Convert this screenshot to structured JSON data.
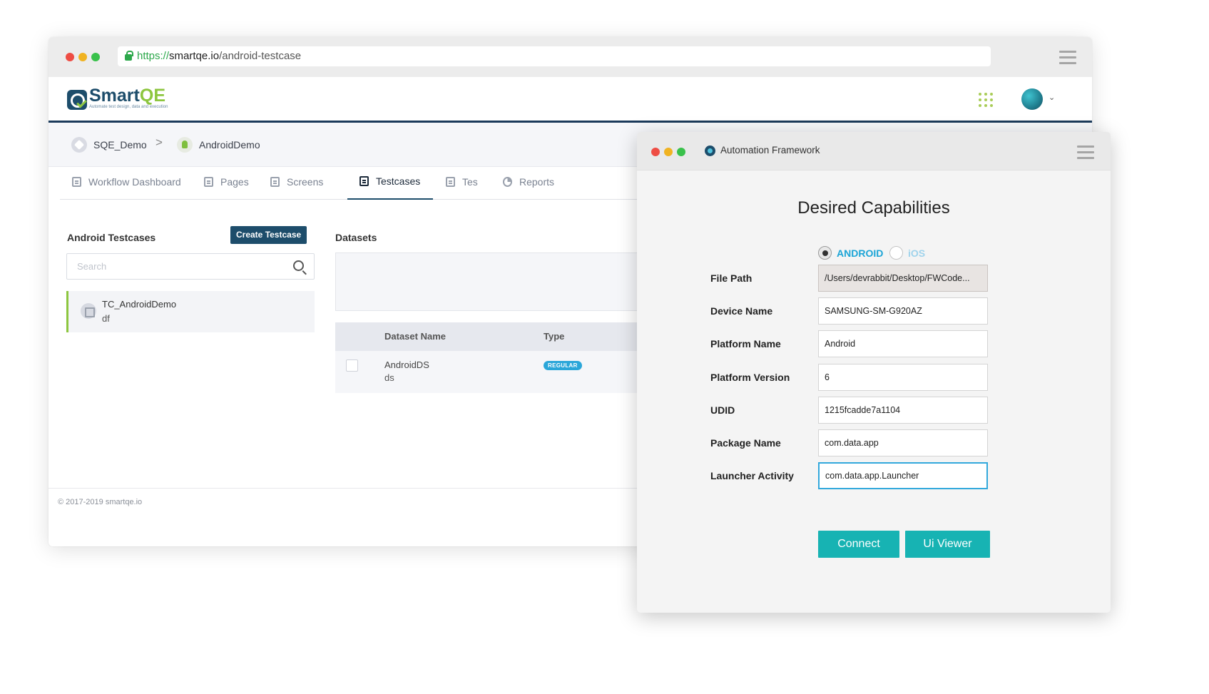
{
  "browser": {
    "url_protocol": "https://",
    "url_domain": "smartqe.io",
    "url_path": "/android-testcase"
  },
  "app": {
    "logo_name_a": "Smart",
    "logo_name_b": "QE",
    "logo_tagline": "Automate test design, data and execution"
  },
  "breadcrumb": {
    "items": [
      "SQE_Demo",
      "AndroidDemo"
    ],
    "separator": ">"
  },
  "tabs": [
    {
      "label": "Workflow Dashboard",
      "icon": "document-icon"
    },
    {
      "label": "Pages",
      "icon": "document-icon"
    },
    {
      "label": "Screens",
      "icon": "screens-icon"
    },
    {
      "label": "Testcases",
      "icon": "checklist-icon",
      "active": true
    },
    {
      "label": "Tes",
      "icon": "document-icon"
    },
    {
      "label": "Reports",
      "icon": "pie-chart-icon"
    }
  ],
  "testcases": {
    "title": "Android Testcases",
    "create_label": "Create Testcase",
    "search_placeholder": "Search",
    "items": [
      {
        "name": "TC_AndroidDemo",
        "sub": "df"
      }
    ]
  },
  "datasets": {
    "title": "Datasets",
    "columns": [
      "Dataset Name",
      "Type"
    ],
    "rows": [
      {
        "name": "AndroidDS",
        "sub": "ds",
        "type": "REGULAR"
      }
    ]
  },
  "footer": {
    "copyright": "© 2017-2019 smartqe.io"
  },
  "window": {
    "title": "Automation Framework",
    "heading": "Desired Capabilities",
    "platform_options": [
      {
        "label": "ANDROID",
        "selected": true
      },
      {
        "label": "iOS",
        "selected": false
      }
    ],
    "fields": [
      {
        "label": "File Path",
        "value": "/Users/devrabbit/Desktop/FWCode..."
      },
      {
        "label": "Device Name",
        "value": "SAMSUNG-SM-G920AZ"
      },
      {
        "label": "Platform Name",
        "value": "Android"
      },
      {
        "label": "Platform Version",
        "value": "6"
      },
      {
        "label": "UDID",
        "value": "1215fcadde7a1104"
      },
      {
        "label": "Package Name",
        "value": "com.data.app"
      },
      {
        "label": "Launcher Activity",
        "value": "com.data.app.Launcher"
      }
    ],
    "connect_label": "Connect",
    "viewer_label": "Ui Viewer"
  },
  "colors": {
    "brand_navy": "#1d4d6b",
    "brand_green": "#8dc63f",
    "teal_button": "#17b3b3",
    "android_blue": "#1ba4d6"
  }
}
